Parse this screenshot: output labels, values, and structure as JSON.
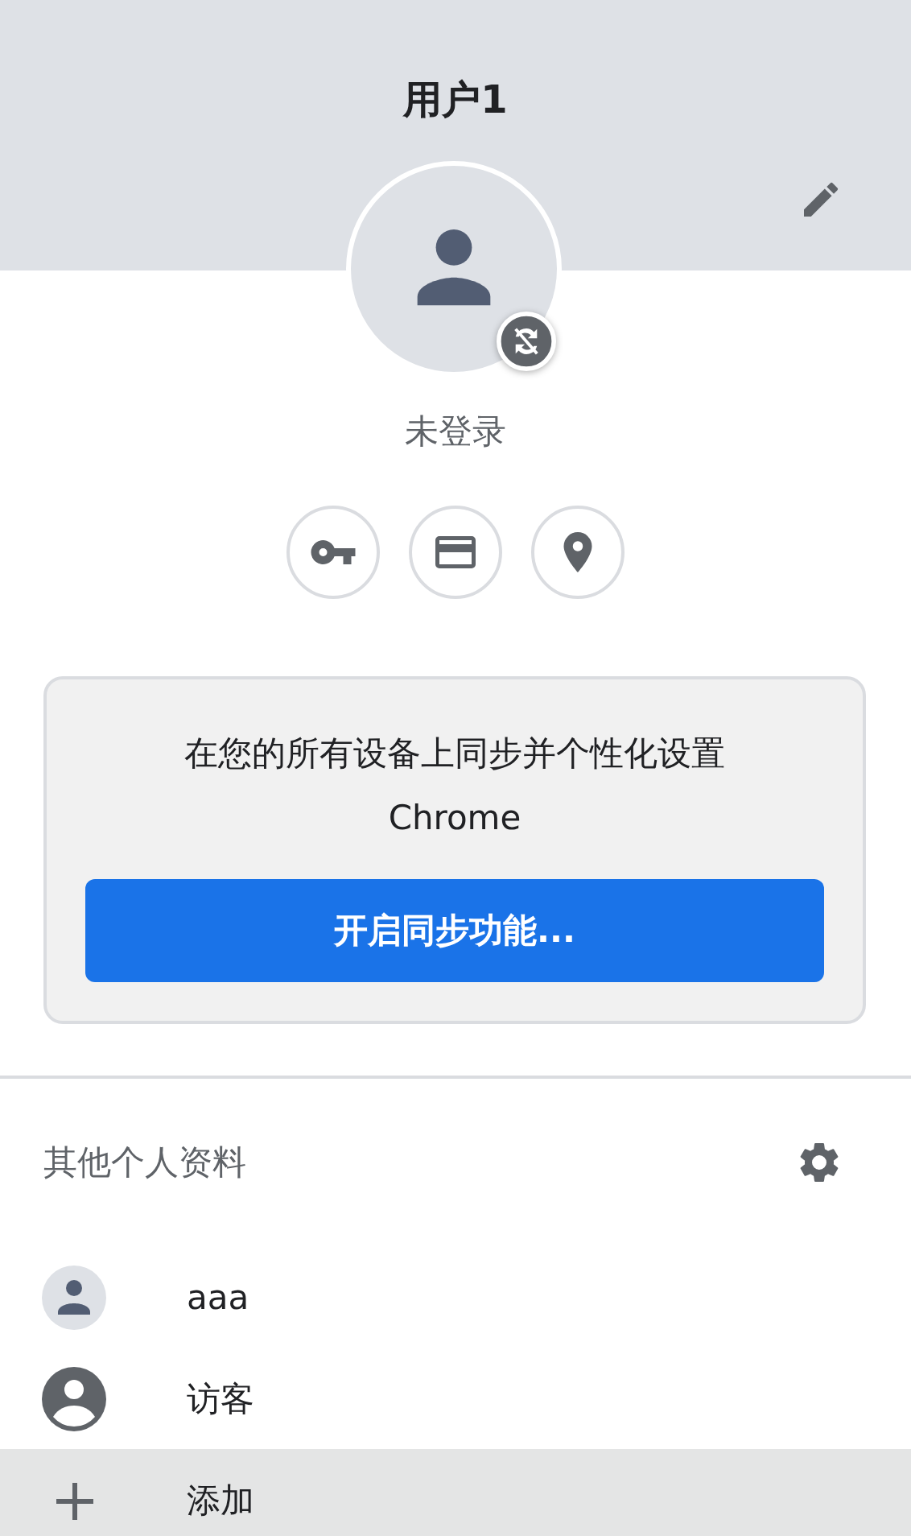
{
  "header": {
    "title": "用户1"
  },
  "account": {
    "status": "未登录",
    "sync_off": true
  },
  "shortcuts": [
    {
      "kind": "key"
    },
    {
      "kind": "card"
    },
    {
      "kind": "pin"
    }
  ],
  "sync_card": {
    "message": "在您的所有设备上同步并个性化设置 Chrome",
    "button": "开启同步功能..."
  },
  "other_profiles": {
    "title": "其他个人资料",
    "items": [
      {
        "kind": "avatar",
        "label": "aaa",
        "highlighted": false
      },
      {
        "kind": "guest",
        "label": "访客",
        "highlighted": false
      },
      {
        "kind": "add",
        "label": "添加",
        "highlighted": true
      }
    ]
  }
}
